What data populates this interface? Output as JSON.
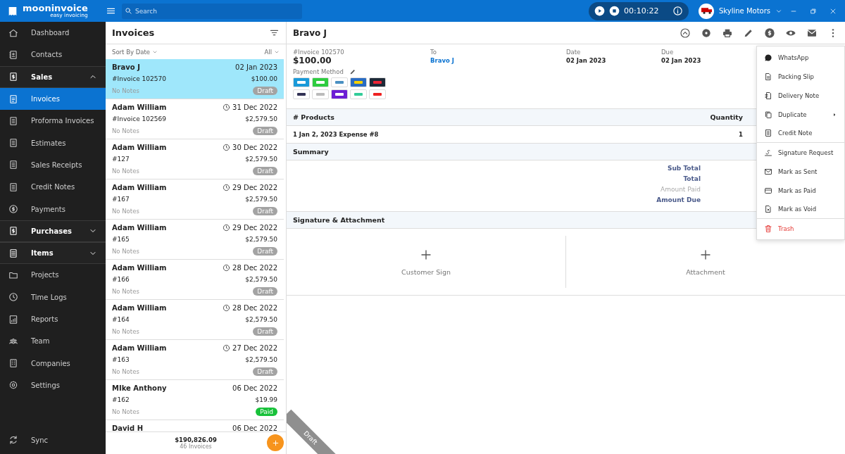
{
  "app": {
    "name": "mooninvoice",
    "tagline": "easy invoicing"
  },
  "search": {
    "placeholder": "Search"
  },
  "timer": {
    "time": "00:10:22"
  },
  "company": {
    "name": "Skyline Motors"
  },
  "sidebar": {
    "items": [
      {
        "kind": "item",
        "label": "Dashboard",
        "selected": false
      },
      {
        "kind": "item",
        "label": "Contacts",
        "selected": false
      },
      {
        "kind": "section",
        "label": "Sales",
        "expanded": true,
        "selected": false
      },
      {
        "kind": "item",
        "label": "Invoices",
        "selected": true
      },
      {
        "kind": "item",
        "label": "Proforma Invoices",
        "selected": false
      },
      {
        "kind": "item",
        "label": "Estimates",
        "selected": false
      },
      {
        "kind": "item",
        "label": "Sales Receipts",
        "selected": false
      },
      {
        "kind": "item",
        "label": "Credit Notes",
        "selected": false
      },
      {
        "kind": "item",
        "label": "Payments",
        "selected": false
      },
      {
        "kind": "section",
        "label": "Purchases",
        "expanded": false,
        "selected": false
      },
      {
        "kind": "section",
        "label": "Items",
        "expanded": false,
        "selected": false
      },
      {
        "kind": "item",
        "label": "Projects",
        "selected": false
      },
      {
        "kind": "item",
        "label": "Time Logs",
        "selected": false
      },
      {
        "kind": "item",
        "label": "Reports",
        "selected": false
      },
      {
        "kind": "item",
        "label": "Team",
        "selected": false
      },
      {
        "kind": "item",
        "label": "Companies",
        "selected": false
      },
      {
        "kind": "item",
        "label": "Settings",
        "selected": false
      }
    ],
    "sync": "Sync"
  },
  "invoice_list": {
    "title": "Invoices",
    "sort": "Sort By Date",
    "filter": "All",
    "rows": [
      {
        "name": "Bravo J",
        "date": "02 Jan 2023",
        "overdue": false,
        "number": "#Invoice 102570",
        "amount": "$100.00",
        "notes": "No Notes",
        "status": "Draft",
        "selected": true
      },
      {
        "name": "Adam William",
        "date": "31 Dec 2022",
        "overdue": true,
        "number": "#Invoice 102569",
        "amount": "$2,579.50",
        "notes": "No Notes",
        "status": "Draft",
        "selected": false
      },
      {
        "name": "Adam William",
        "date": "30 Dec 2022",
        "overdue": true,
        "number": "#127",
        "amount": "$2,579.50",
        "notes": "No Notes",
        "status": "Draft",
        "selected": false
      },
      {
        "name": "Adam William",
        "date": "29 Dec 2022",
        "overdue": true,
        "number": "#167",
        "amount": "$2,579.50",
        "notes": "No Notes",
        "status": "Draft",
        "selected": false
      },
      {
        "name": "Adam William",
        "date": "29 Dec 2022",
        "overdue": true,
        "number": "#165",
        "amount": "$2,579.50",
        "notes": "No Notes",
        "status": "Draft",
        "selected": false
      },
      {
        "name": "Adam William",
        "date": "28 Dec 2022",
        "overdue": true,
        "number": "#166",
        "amount": "$2,579.50",
        "notes": "No Notes",
        "status": "Draft",
        "selected": false
      },
      {
        "name": "Adam William",
        "date": "28 Dec 2022",
        "overdue": true,
        "number": "#164",
        "amount": "$2,579.50",
        "notes": "No Notes",
        "status": "Draft",
        "selected": false
      },
      {
        "name": "Adam William",
        "date": "27 Dec 2022",
        "overdue": true,
        "number": "#163",
        "amount": "$2,579.50",
        "notes": "No Notes",
        "status": "Draft",
        "selected": false
      },
      {
        "name": "MIke Anthony",
        "date": "06 Dec 2022",
        "overdue": false,
        "number": "#162",
        "amount": "$19.99",
        "notes": "No Notes",
        "status": "Paid",
        "color": "#18c13a",
        "selected": false
      },
      {
        "name": "David H",
        "date": "06 Dec 2022",
        "overdue": false,
        "selected": false
      }
    ],
    "total": "$190,826.09",
    "count": "46 Invoices"
  },
  "detail": {
    "title": "Bravo J",
    "number": "#Invoice 102570",
    "amount": "$100.00",
    "payment_method_label": "Payment Method",
    "to_label": "To",
    "to": "Bravo J",
    "date_label": "Date",
    "date": "02 Jan 2023",
    "due_label": "Due",
    "due": "02 Jan 2023",
    "products": {
      "columns": [
        "# Products",
        "Quantity"
      ],
      "rows": [
        [
          "1 Jan 2, 2023 Expense #8",
          "1"
        ]
      ]
    },
    "summary": {
      "title": "Summary",
      "lines": [
        {
          "label": "Sub Total",
          "kind": "strong"
        },
        {
          "label": "Total",
          "kind": "strong"
        },
        {
          "label": "Amount Paid",
          "kind": "muted"
        },
        {
          "label": "Amount Due",
          "kind": "strong"
        }
      ]
    },
    "signature": {
      "title": "Signature & Attachment",
      "slots": [
        "Customer Sign",
        "Attachment"
      ]
    },
    "ribbon": "Draft"
  },
  "menu": {
    "items": [
      {
        "label": "WhatsApp",
        "kind": "normal",
        "submenu": false,
        "divider_after": false
      },
      {
        "label": "Packing Slip",
        "kind": "normal",
        "submenu": false,
        "divider_after": false
      },
      {
        "label": "Delivery Note",
        "kind": "normal",
        "submenu": false,
        "divider_after": false
      },
      {
        "label": "Duplicate",
        "kind": "normal",
        "submenu": true,
        "divider_after": false
      },
      {
        "label": "Credit Note",
        "kind": "normal",
        "submenu": false,
        "divider_after": true
      },
      {
        "label": "Signature Request",
        "kind": "normal",
        "submenu": false,
        "divider_after": false
      },
      {
        "label": "Mark as Sent",
        "kind": "normal",
        "submenu": false,
        "divider_after": false
      },
      {
        "label": "Mark as Paid",
        "kind": "normal",
        "submenu": false,
        "divider_after": false
      },
      {
        "label": "Mark as Void",
        "kind": "normal",
        "submenu": false,
        "divider_after": true
      },
      {
        "label": "Trash",
        "kind": "danger",
        "submenu": false,
        "divider_after": false
      }
    ]
  }
}
